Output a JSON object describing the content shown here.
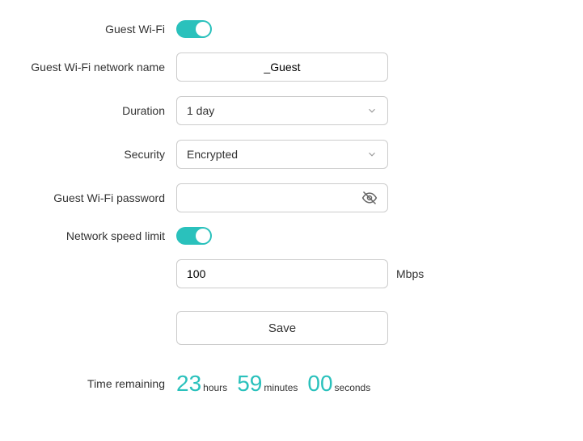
{
  "labels": {
    "guestWifi": "Guest Wi-Fi",
    "networkName": "Guest Wi-Fi network name",
    "duration": "Duration",
    "security": "Security",
    "password": "Guest Wi-Fi password",
    "speedLimit": "Network speed limit",
    "timeRemaining": "Time remaining"
  },
  "values": {
    "guestWifiEnabled": true,
    "networkName": "_Guest",
    "duration": "1 day",
    "security": "Encrypted",
    "password": "",
    "speedLimitEnabled": true,
    "speedLimit": "100",
    "speedUnit": "Mbps"
  },
  "buttons": {
    "save": "Save"
  },
  "countdown": {
    "hours": "23",
    "hoursLabel": "hours",
    "minutes": "59",
    "minutesLabel": "minutes",
    "seconds": "00",
    "secondsLabel": "seconds"
  }
}
